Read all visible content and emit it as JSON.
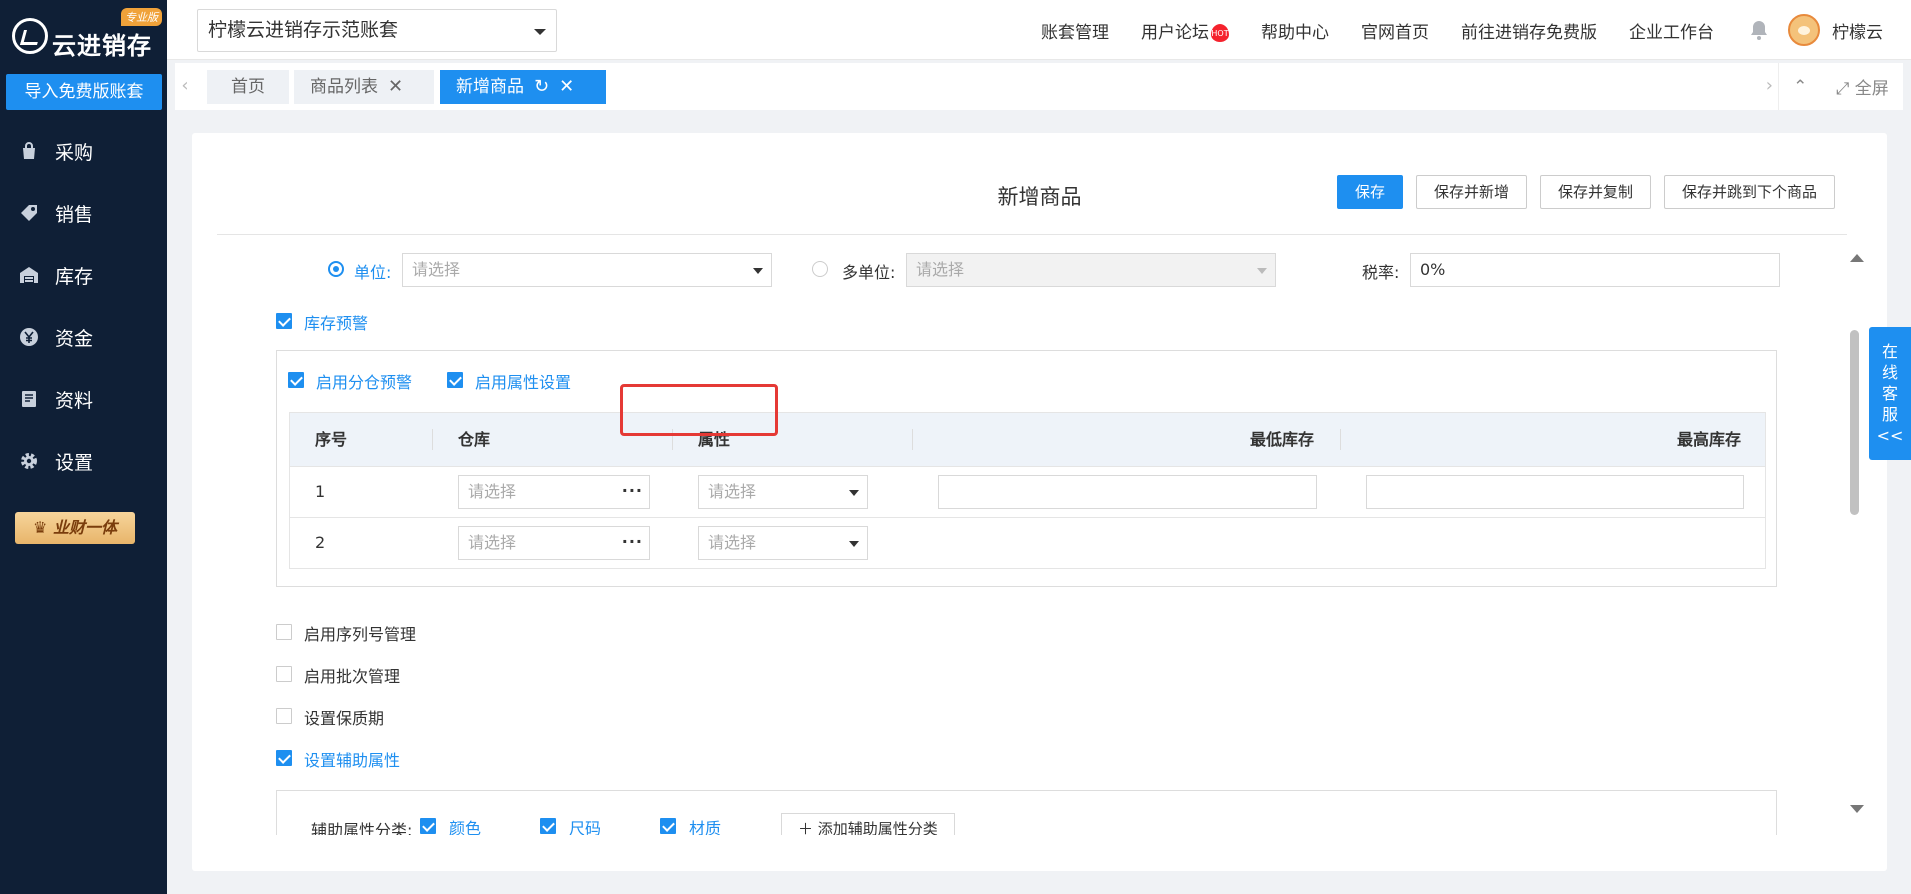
{
  "app": {
    "name": "云进销存",
    "edition": "专业版"
  },
  "sidebar": {
    "import_label": "导入免费版账套",
    "items": [
      {
        "label": "采购",
        "icon": "shopping-bag-icon"
      },
      {
        "label": "销售",
        "icon": "tag-icon"
      },
      {
        "label": "库存",
        "icon": "warehouse-icon"
      },
      {
        "label": "资金",
        "icon": "yen-coin-icon"
      },
      {
        "label": "资料",
        "icon": "document-icon"
      },
      {
        "label": "设置",
        "icon": "gear-icon"
      }
    ],
    "badge": "业财一体"
  },
  "topbar": {
    "account": "柠檬云进销存示范账套",
    "links": [
      "账套管理",
      "用户论坛",
      "帮助中心",
      "官网首页",
      "前往进销存免费版",
      "企业工作台"
    ],
    "hot_badge": "HOT",
    "username": "柠檬云"
  },
  "tabs": {
    "items": [
      {
        "label": "首页"
      },
      {
        "label": "商品列表"
      },
      {
        "label": "新增商品"
      }
    ],
    "fullscreen": "全屏"
  },
  "form": {
    "title": "新增商品",
    "buttons": {
      "save": "保存",
      "save_new": "保存并新增",
      "save_copy": "保存并复制",
      "save_next": "保存并跳到下个商品"
    },
    "unit_label": "单位:",
    "unit_placeholder": "请选择",
    "multi_unit_label": "多单位:",
    "multi_unit_placeholder": "请选择",
    "tax_label": "税率:",
    "tax_value": "0%",
    "stock_alert": "库存预警",
    "warehouse_alert": "启用分仓预警",
    "attr_setting": "启用属性设置",
    "table": {
      "headers": [
        "序号",
        "仓库",
        "属性",
        "最低库存",
        "最高库存"
      ],
      "rows": [
        {
          "no": "1",
          "warehouse": "请选择",
          "attr": "请选择",
          "min": "",
          "max": ""
        },
        {
          "no": "2",
          "warehouse": "请选择",
          "attr": "请选择"
        }
      ]
    },
    "serial": "启用序列号管理",
    "batch": "启用批次管理",
    "shelf_life": "设置保质期",
    "aux_attr": "设置辅助属性",
    "aux_category_label": "辅助属性分类:",
    "aux_categories": [
      "颜色",
      "尺码",
      "材质"
    ],
    "add_aux": "添加辅助属性分类"
  },
  "service": {
    "label": "在线客服",
    "arrows": "<<"
  }
}
